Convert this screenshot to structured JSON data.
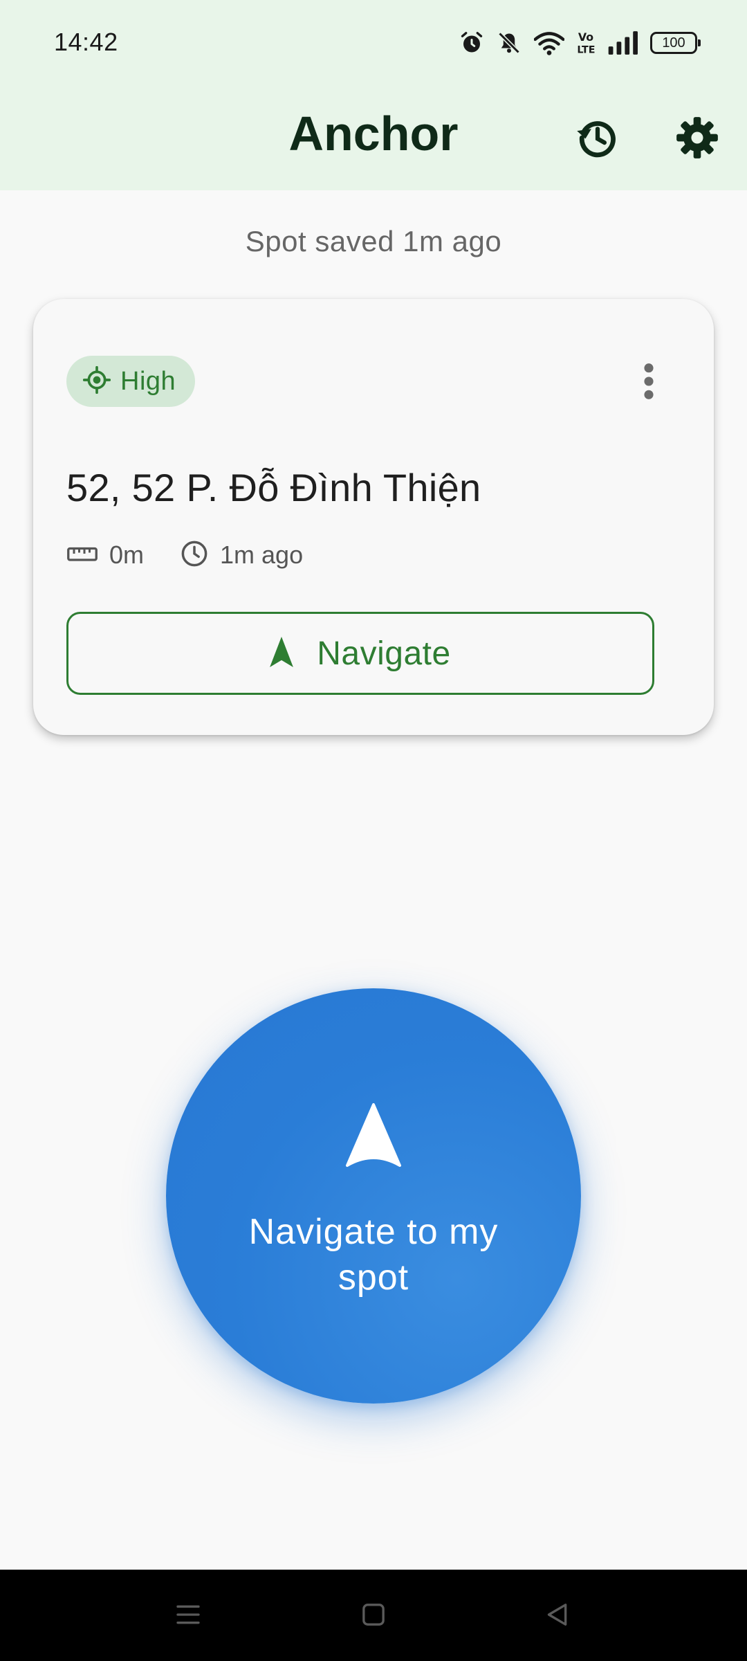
{
  "status_bar": {
    "time": "14:42",
    "icons": [
      "alarm-icon",
      "bell-off-icon",
      "wifi-icon",
      "volte-icon",
      "signal-icon",
      "battery-icon"
    ],
    "volte_label": "Vo\nLTE",
    "battery_level": "100"
  },
  "app_bar": {
    "title": "Anchor",
    "actions": [
      "history-icon",
      "settings-icon"
    ]
  },
  "saved_caption": "Spot saved 1m ago",
  "spot_card": {
    "accuracy_chip": {
      "icon": "gps-fixed-icon",
      "label": "High"
    },
    "menu_icon": "more-vert-icon",
    "address": "52, 52 P. Đỗ Đình Thiện",
    "distance": {
      "icon": "ruler-icon",
      "value": "0m"
    },
    "age": {
      "icon": "clock-icon",
      "value": "1m ago"
    },
    "navigate_button": {
      "icon": "navigation-arrow-icon",
      "label": "Navigate"
    }
  },
  "primary_action": {
    "icon": "navigation-arrow-icon",
    "label": "Navigate to my spot"
  },
  "system_nav": [
    "menu-icon",
    "home-icon",
    "back-icon"
  ],
  "colors": {
    "accent_green": "#2e7d32",
    "chip_bg": "#d3e8d6",
    "app_bar_bg": "#e8f5e9",
    "primary_blue": "#2a7dd7",
    "title_color": "#0f2a18"
  }
}
